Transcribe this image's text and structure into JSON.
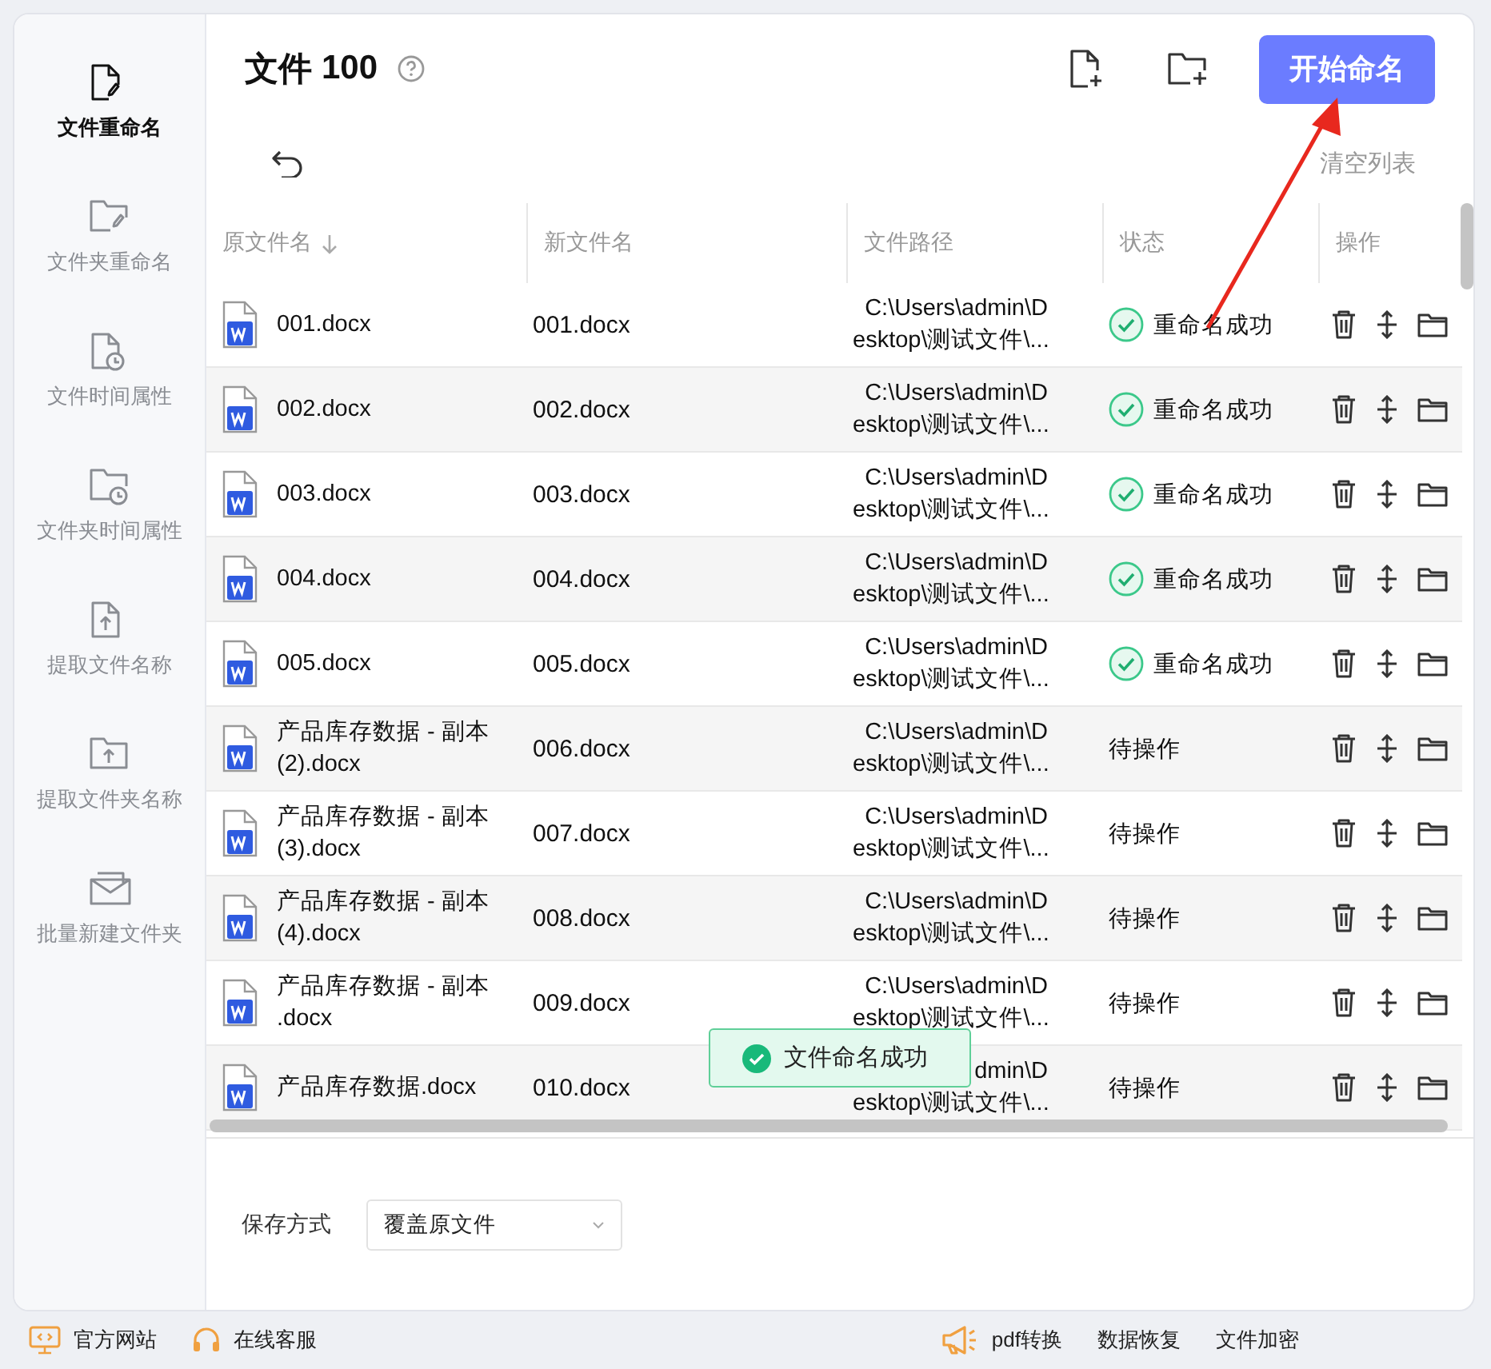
{
  "sidebar": {
    "items": [
      {
        "label": "文件重命名",
        "kind": "file",
        "selected": true
      },
      {
        "label": "文件夹重命名",
        "kind": "folder",
        "selected": false
      },
      {
        "label": "文件时间属性",
        "kind": "filetime",
        "selected": false
      },
      {
        "label": "文件夹时间属性",
        "kind": "foldertime",
        "selected": false
      },
      {
        "label": "提取文件名称",
        "kind": "fileextract",
        "selected": false
      },
      {
        "label": "提取文件夹名称",
        "kind": "folderextract",
        "selected": false
      },
      {
        "label": "批量新建文件夹",
        "kind": "batch",
        "selected": false
      }
    ]
  },
  "header": {
    "title": "文件",
    "count": "100",
    "start_button": "开始命名",
    "clear_link": "清空列表"
  },
  "table": {
    "columns": [
      "原文件名",
      "新文件名",
      "文件路径",
      "状态",
      "操作"
    ],
    "rows": [
      {
        "name": "001.docx",
        "new_name": "001.docx",
        "path": "C:\\Users\\admin\\D\nesktop\\测试文件\\...",
        "status": "重命名成功",
        "kind": "done"
      },
      {
        "name": "002.docx",
        "new_name": "002.docx",
        "path": "C:\\Users\\admin\\D\nesktop\\测试文件\\...",
        "status": "重命名成功",
        "kind": "done"
      },
      {
        "name": "003.docx",
        "new_name": "003.docx",
        "path": "C:\\Users\\admin\\D\nesktop\\测试文件\\...",
        "status": "重命名成功",
        "kind": "done"
      },
      {
        "name": "004.docx",
        "new_name": "004.docx",
        "path": "C:\\Users\\admin\\D\nesktop\\测试文件\\...",
        "status": "重命名成功",
        "kind": "done"
      },
      {
        "name": "005.docx",
        "new_name": "005.docx",
        "path": "C:\\Users\\admin\\D\nesktop\\测试文件\\...",
        "status": "重命名成功",
        "kind": "done"
      },
      {
        "name": "产品库存数据 - 副本\n(2).docx",
        "new_name": "006.docx",
        "path": "C:\\Users\\admin\\D\nesktop\\测试文件\\...",
        "status": "待操作",
        "kind": "pending"
      },
      {
        "name": "产品库存数据 - 副本\n(3).docx",
        "new_name": "007.docx",
        "path": "C:\\Users\\admin\\D\nesktop\\测试文件\\...",
        "status": "待操作",
        "kind": "pending"
      },
      {
        "name": "产品库存数据 - 副本\n(4).docx",
        "new_name": "008.docx",
        "path": "C:\\Users\\admin\\D\nesktop\\测试文件\\...",
        "status": "待操作",
        "kind": "pending"
      },
      {
        "name": "产品库存数据 - 副本\n.docx",
        "new_name": "009.docx",
        "path": "C:\\Users\\admin\\D\nesktop\\测试文件\\...",
        "status": "待操作",
        "kind": "pending"
      },
      {
        "name": "产品库存数据.docx",
        "new_name": "010.docx",
        "path": "dmin\\D\nesktop\\测试文件\\...",
        "status": "待操作",
        "kind": "pending"
      }
    ]
  },
  "toast": {
    "text": "文件命名成功"
  },
  "save": {
    "label": "保存方式",
    "value": "覆盖原文件"
  },
  "footer": {
    "links": [
      {
        "label": "官方网站",
        "kind": "website"
      },
      {
        "label": "在线客服",
        "kind": "support"
      },
      {
        "label": "pdf转换",
        "kind": "promo"
      },
      {
        "label": "数据恢复",
        "kind": "plain"
      },
      {
        "label": "文件加密",
        "kind": "plain"
      }
    ]
  }
}
